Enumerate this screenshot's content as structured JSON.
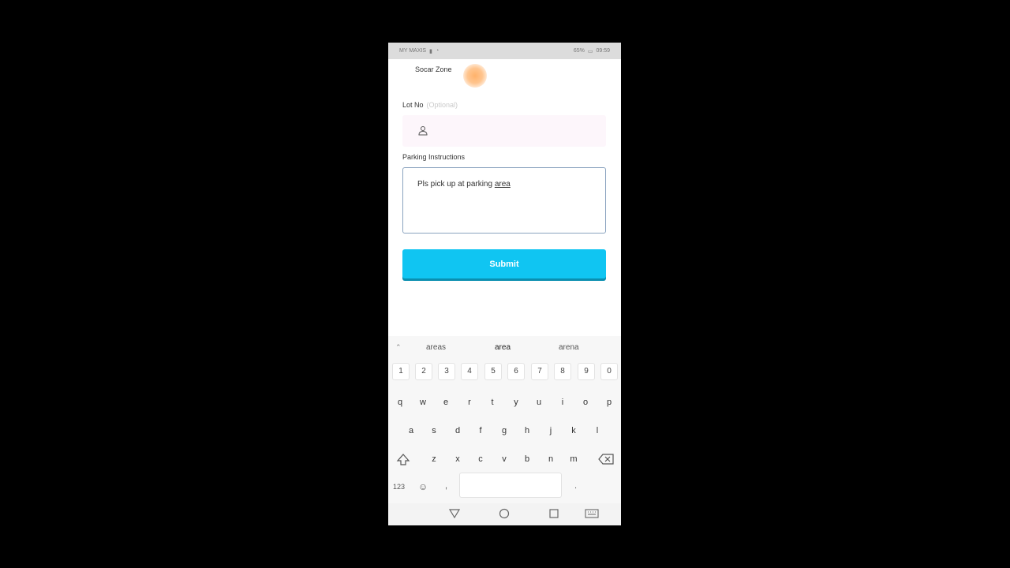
{
  "status_bar": {
    "carrier": "MY MAXIS",
    "battery_text": "65%",
    "time": "09:59"
  },
  "form": {
    "zone_label": "Socar Zone",
    "lot_label": "Lot No",
    "lot_optional": "(Optional)",
    "lot_placeholder": "",
    "instructions_label": "Parking Instructions",
    "instructions_value_prefix": "Pls pick up at parking ",
    "instructions_value_underlined": "area",
    "submit_label": "Submit"
  },
  "keyboard": {
    "suggestions": [
      "areas",
      "area",
      "arena"
    ],
    "numbers": [
      "1",
      "2",
      "3",
      "4",
      "5",
      "6",
      "7",
      "8",
      "9",
      "0"
    ],
    "row_q": [
      "q",
      "w",
      "e",
      "r",
      "t",
      "y",
      "u",
      "i",
      "o",
      "p"
    ],
    "row_a": [
      "a",
      "s",
      "d",
      "f",
      "g",
      "h",
      "j",
      "k",
      "l"
    ],
    "row_z": [
      "z",
      "x",
      "c",
      "v",
      "b",
      "n",
      "m"
    ],
    "mode_key": "123",
    "comma_key": ",",
    "period_key": "."
  },
  "icons": {
    "person": "person-icon",
    "shift": "shift-icon",
    "backspace": "backspace-icon",
    "enter": "enter-icon",
    "emoji": "emoji-icon",
    "back": "nav-back-icon",
    "home": "nav-home-icon",
    "recents": "nav-recents-icon",
    "keyboard_toggle": "keyboard-toggle-icon"
  },
  "colors": {
    "accent": "#10c5f2",
    "zone_dot": "#ffb26b"
  }
}
